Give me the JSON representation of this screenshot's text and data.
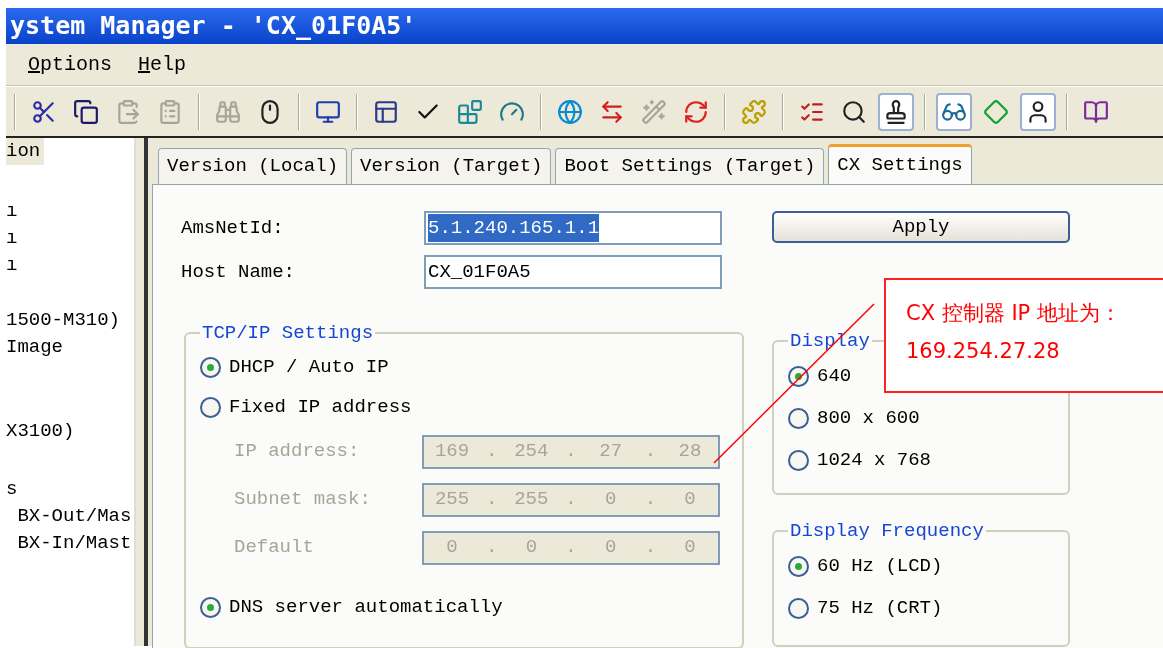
{
  "window": {
    "title": "ystem Manager - 'CX_01F0A5'"
  },
  "menu": [
    {
      "label": "Options"
    },
    {
      "label": "Help"
    }
  ],
  "toolbar": [
    {
      "kind": "separator"
    },
    {
      "kind": "cut",
      "pressed": false,
      "disabled": false
    },
    {
      "kind": "copy",
      "pressed": false,
      "disabled": false
    },
    {
      "kind": "paste",
      "pressed": false,
      "disabled": true
    },
    {
      "kind": "paste-special",
      "pressed": false,
      "disabled": true
    },
    {
      "kind": "separator"
    },
    {
      "kind": "find",
      "pressed": false,
      "disabled": true
    },
    {
      "kind": "mouse",
      "pressed": false,
      "disabled": false
    },
    {
      "kind": "separator"
    },
    {
      "kind": "computer",
      "pressed": false,
      "disabled": false
    },
    {
      "kind": "separator"
    },
    {
      "kind": "panels",
      "pressed": false,
      "disabled": false
    },
    {
      "kind": "check",
      "pressed": false,
      "disabled": false
    },
    {
      "kind": "blocks",
      "pressed": false,
      "disabled": false
    },
    {
      "kind": "gauge",
      "pressed": false,
      "disabled": false
    },
    {
      "kind": "separator"
    },
    {
      "kind": "globe",
      "pressed": false,
      "disabled": false
    },
    {
      "kind": "swap",
      "pressed": false,
      "disabled": false
    },
    {
      "kind": "wand",
      "pressed": false,
      "disabled": true
    },
    {
      "kind": "refresh",
      "pressed": false,
      "disabled": false
    },
    {
      "kind": "separator"
    },
    {
      "kind": "puzzle",
      "pressed": false,
      "disabled": false
    },
    {
      "kind": "separator"
    },
    {
      "kind": "list",
      "pressed": false,
      "disabled": false
    },
    {
      "kind": "search",
      "pressed": false,
      "disabled": false
    },
    {
      "kind": "stamp",
      "pressed": true,
      "disabled": false
    },
    {
      "kind": "separator"
    },
    {
      "kind": "glasses",
      "pressed": true,
      "disabled": false
    },
    {
      "kind": "diamond",
      "pressed": false,
      "disabled": false
    },
    {
      "kind": "person",
      "pressed": true,
      "disabled": false
    },
    {
      "kind": "separator"
    },
    {
      "kind": "book",
      "pressed": false,
      "disabled": false
    }
  ],
  "tree": {
    "items": [
      {
        "label": "ion",
        "selected": true
      },
      {
        "label": "ı",
        "selected": false
      },
      {
        "label": "ı",
        "selected": false
      },
      {
        "label": "ı",
        "selected": false
      },
      {
        "label": "1500-M310)",
        "selected": false
      },
      {
        "label": "Image",
        "selected": false
      },
      {
        "label": "X3100)",
        "selected": false
      },
      {
        "label": "s",
        "selected": false
      },
      {
        "label": " BX-Out/Mas",
        "selected": false
      },
      {
        "label": " BX-In/Mast",
        "selected": false
      }
    ]
  },
  "tabs": [
    {
      "label": "Version (Local)",
      "selected": false
    },
    {
      "label": "Version (Target)",
      "selected": false
    },
    {
      "label": "Boot Settings (Target)",
      "selected": false
    },
    {
      "label": "CX Settings",
      "selected": true
    }
  ],
  "form": {
    "ams_net_id": {
      "label": "AmsNetId:",
      "value": "5.1.240.165.1.1",
      "highlighted": true
    },
    "host_name": {
      "label": "Host Name:",
      "value": "CX_01F0A5",
      "highlighted": false
    },
    "apply_button": "Apply"
  },
  "tcp_ip": {
    "title": "TCP/IP Settings",
    "modes": [
      {
        "label": "DHCP / Auto IP",
        "selected": true
      },
      {
        "label": "Fixed IP address",
        "selected": false
      }
    ],
    "fields": [
      {
        "label": "IP address:",
        "octets": [
          "169",
          "254",
          "27",
          "28"
        ],
        "separator": ".",
        "disabled": true
      },
      {
        "label": "Subnet mask:",
        "octets": [
          "255",
          "255",
          "0",
          "0"
        ],
        "separator": ".",
        "disabled": true
      },
      {
        "label": "Default",
        "octets": [
          "0",
          "0",
          "0",
          "0"
        ],
        "separator": ".",
        "disabled": true
      }
    ],
    "dns": {
      "label": "DNS server automatically",
      "selected": true
    }
  },
  "display": {
    "title": "Display",
    "options": [
      {
        "label": "640",
        "selected": true
      },
      {
        "label": "800 x 600",
        "selected": false
      },
      {
        "label": "1024 x 768",
        "selected": false
      }
    ]
  },
  "frequency": {
    "title": "Display Frequency",
    "options": [
      {
        "label": "60 Hz (LCD)",
        "selected": true
      },
      {
        "label": "75 Hz (CRT)",
        "selected": false
      }
    ]
  },
  "callout": {
    "lines": [
      "CX 控制器 IP 地址为：",
      "169.254.27.28"
    ]
  }
}
